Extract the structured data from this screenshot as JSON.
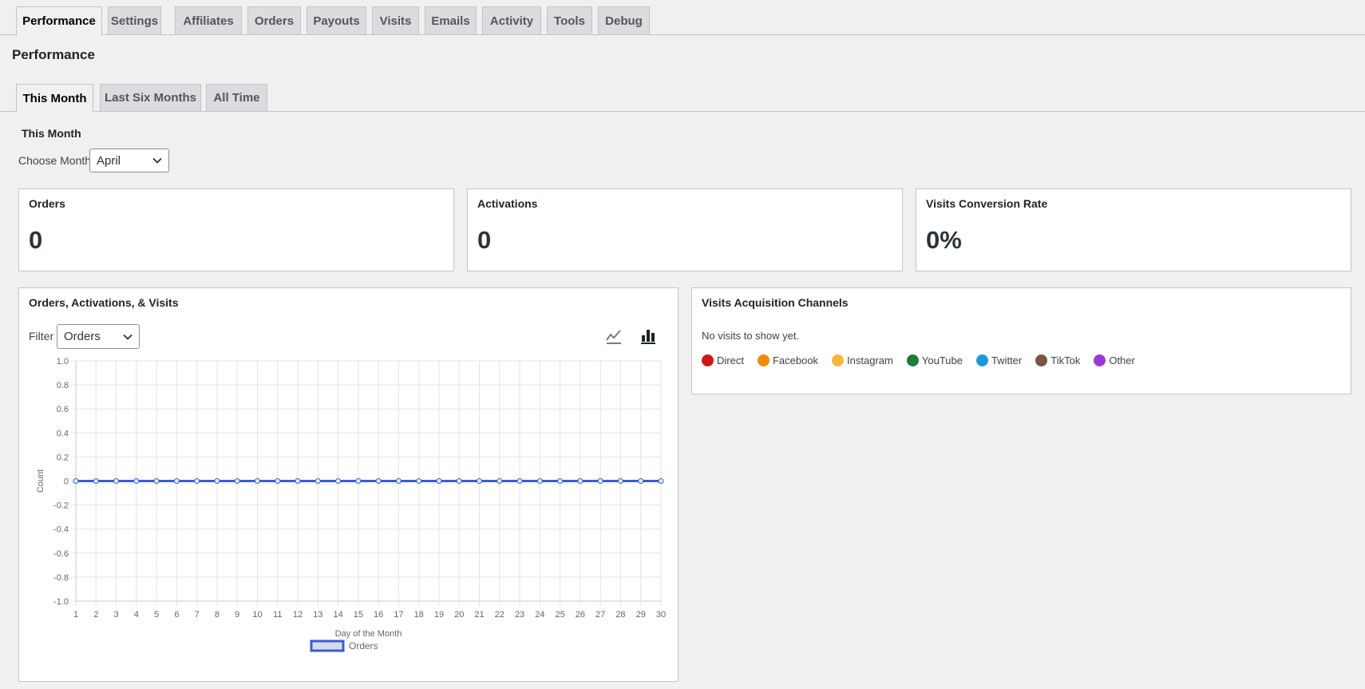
{
  "top_tabs": [
    {
      "label": "Performance",
      "active": true
    },
    {
      "label": "Settings"
    },
    {
      "label": "Affiliates"
    },
    {
      "label": "Orders"
    },
    {
      "label": "Payouts"
    },
    {
      "label": "Visits"
    },
    {
      "label": "Emails"
    },
    {
      "label": "Activity"
    },
    {
      "label": "Tools"
    },
    {
      "label": "Debug"
    }
  ],
  "page_title": "Performance",
  "sub_tabs": [
    {
      "label": "This Month",
      "active": true
    },
    {
      "label": "Last Six Months"
    },
    {
      "label": "All Time"
    }
  ],
  "section_title": "This Month",
  "month_picker": {
    "label": "Choose Month",
    "value": "April"
  },
  "stats": [
    {
      "title": "Orders",
      "value": "0"
    },
    {
      "title": "Activations",
      "value": "0"
    },
    {
      "title": "Visits Conversion Rate",
      "value": "0%"
    }
  ],
  "chart_panel": {
    "title": "Orders, Activations, & Visits",
    "filter_label": "Filter",
    "filter_value": "Orders",
    "line_icon": "line-chart-icon",
    "bar_icon": "bar-chart-icon"
  },
  "channels_panel": {
    "title": "Visits Acquisition Channels",
    "empty_text": "No visits to show yet.",
    "channels": [
      {
        "label": "Direct",
        "color": "#cc1818"
      },
      {
        "label": "Facebook",
        "color": "#f0890c"
      },
      {
        "label": "Instagram",
        "color": "#f6b63e"
      },
      {
        "label": "YouTube",
        "color": "#1c7c3b"
      },
      {
        "label": "Twitter",
        "color": "#1a9bd8"
      },
      {
        "label": "TikTok",
        "color": "#795548"
      },
      {
        "label": "Other",
        "color": "#9b39d6"
      }
    ]
  },
  "chart_data": {
    "type": "line",
    "title": "",
    "xlabel": "Day of the Month",
    "ylabel": "Count",
    "x": [
      1,
      2,
      3,
      4,
      5,
      6,
      7,
      8,
      9,
      10,
      11,
      12,
      13,
      14,
      15,
      16,
      17,
      18,
      19,
      20,
      21,
      22,
      23,
      24,
      25,
      26,
      27,
      28,
      29,
      30
    ],
    "ylim": [
      -1.0,
      1.0
    ],
    "yticks": [
      "1.0",
      "0.8",
      "0.6",
      "0.4",
      "0.2",
      "0",
      "-0.2",
      "-0.4",
      "-0.6",
      "-0.8",
      "-1.0"
    ],
    "grid": true,
    "legend_position": "bottom",
    "series": [
      {
        "name": "Orders",
        "color": "#3b5bdb",
        "values": [
          0,
          0,
          0,
          0,
          0,
          0,
          0,
          0,
          0,
          0,
          0,
          0,
          0,
          0,
          0,
          0,
          0,
          0,
          0,
          0,
          0,
          0,
          0,
          0,
          0,
          0,
          0,
          0,
          0,
          0
        ]
      }
    ]
  }
}
